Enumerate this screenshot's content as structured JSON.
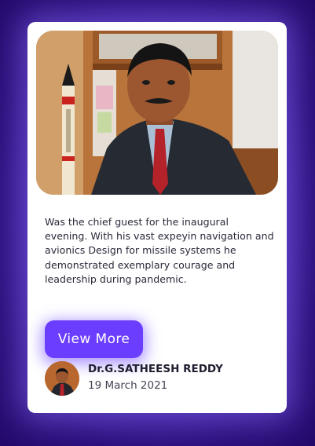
{
  "card": {
    "photo_alt": "Dr.G.SATHEESH REDDY portrait",
    "description": "Was the chief guest for the inaugural evening. With his vast expeyin navigation and avionics Design for missile systems he demonstrated exemplary courage and leadership during pandemic.",
    "button_label": "View More",
    "author": {
      "name": "Dr.G.SATHEESH REDDY",
      "date": "19 March 2021"
    }
  },
  "colors": {
    "background": "#2a0f7a",
    "accent": "#6a3dff",
    "card": "#ffffff"
  }
}
